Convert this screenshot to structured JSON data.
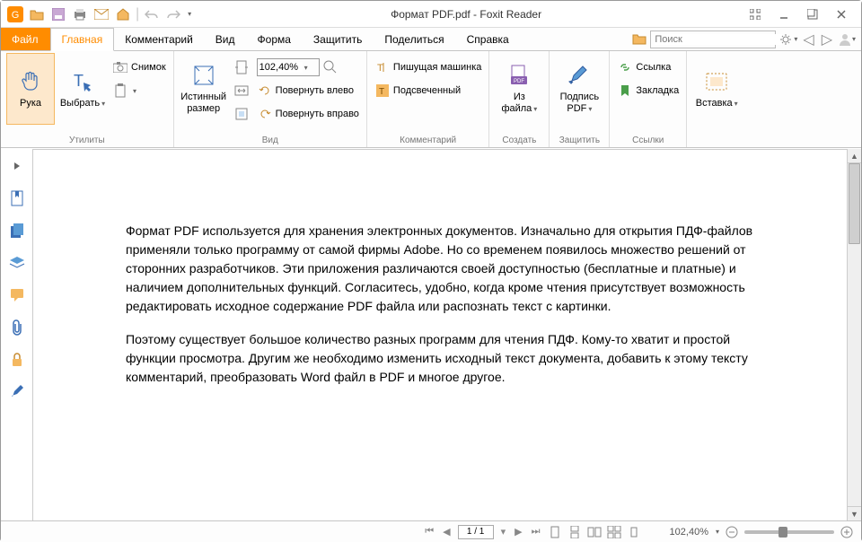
{
  "app": {
    "title": "Формат PDF.pdf - Foxit Reader"
  },
  "tabs": {
    "file": "Файл",
    "home": "Главная",
    "comment": "Комментарий",
    "view": "Вид",
    "form": "Форма",
    "protect": "Защитить",
    "share": "Поделиться",
    "help": "Справка"
  },
  "search": {
    "placeholder": "Поиск"
  },
  "ribbon": {
    "hand": "Рука",
    "select": "Выбрать",
    "snapshot": "Снимок",
    "actual": "Истинный размер",
    "zoom_val": "102,40%",
    "rotate_left": "Повернуть влево",
    "rotate_right": "Повернуть вправо",
    "typewriter": "Пишущая машинка",
    "highlight": "Подсвеченный",
    "fromfile": "Из файла",
    "pdfsign": "Подпись PDF",
    "link": "Ссылка",
    "bookmark": "Закладка",
    "insert": "Вставка",
    "grp_tools": "Утилиты",
    "grp_view": "Вид",
    "grp_comment": "Комментарий",
    "grp_create": "Создать",
    "grp_protect": "Защитить",
    "grp_links": "Ссылки"
  },
  "doc": {
    "p1": "Формат PDF используется для хранения электронных документов. Изначально для открытия ПДФ-файлов применяли только программу от самой фирмы Adobe. Но со временем появилось множество решений от сторонних разработчиков. Эти приложения различаются своей доступностью (бесплатные и платные) и наличием дополнительных функций. Согласитесь, удобно, когда кроме чтения присутствует возможность редактировать исходное содержание PDF файла или распознать текст с картинки.",
    "p2": "Поэтому существует большое количество разных программ для чтения ПДФ. Кому-то хватит и простой функции просмотра. Другим же необходимо изменить исходный текст документа, добавить к этому тексту комментарий, преобразовать Word файл в PDF и многое другое."
  },
  "status": {
    "page": "1 / 1",
    "zoom": "102,40%"
  }
}
